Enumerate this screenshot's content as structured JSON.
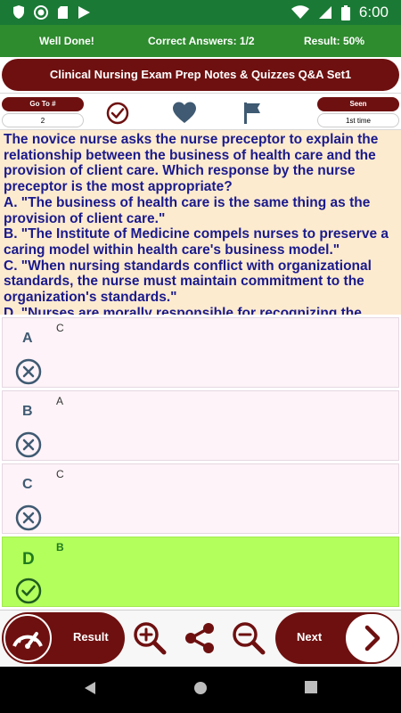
{
  "status_bar": {
    "time": "6:00",
    "left_icons": [
      "shield-icon",
      "record-icon",
      "sd-card-icon",
      "play-store-icon"
    ],
    "right_icons": [
      "wifi-icon",
      "signal-icon",
      "battery-icon"
    ]
  },
  "score_bar": {
    "message": "Well Done!",
    "correct_answers": "Correct Answers: 1/2",
    "result": "Result: 50%"
  },
  "title": "Clinical Nursing Exam Prep Notes & Quizzes Q&A Set1",
  "toolbar": {
    "goto_label": "Go To #",
    "goto_value": "2",
    "seen_label": "Seen",
    "seen_value": "1st time",
    "icons": [
      "check-circle-icon",
      "heart-icon",
      "flag-icon"
    ]
  },
  "question": {
    "text": "The novice nurse asks the nurse preceptor to explain the relationship between the business of health care and the provision of client care. Which response by the nurse preceptor is the most appropriate?",
    "options": [
      "A. \"The business of health care is the same thing as the provision of client care.\"",
      "B. \"The Institute of Medicine compels nurses to preserve a caring model within health care's business model.\"",
      "C. \"When nursing standards conflict with organizational standards, the nurse must maintain commitment to the organization's standards.\"",
      "D. \"Nurses are morally responsible for recognizing the business"
    ]
  },
  "answers": [
    {
      "letter": "A",
      "value": "C",
      "status": "wrong"
    },
    {
      "letter": "B",
      "value": "A",
      "status": "wrong"
    },
    {
      "letter": "C",
      "value": "C",
      "status": "wrong"
    },
    {
      "letter": "D",
      "value": "B",
      "status": "correct"
    }
  ],
  "bottom_bar": {
    "result_label": "Result",
    "next_label": "Next",
    "icons": [
      "result-gauge-icon",
      "zoom-in-icon",
      "share-icon",
      "zoom-out-icon",
      "chevron-right-icon"
    ]
  },
  "colors": {
    "status_green": "#1a7a35",
    "score_green": "#2e8b2e",
    "maroon": "#6e1010",
    "question_bg": "#fdebd0",
    "question_text": "#1a1a8c",
    "correct_bg": "#b3ff5c"
  }
}
